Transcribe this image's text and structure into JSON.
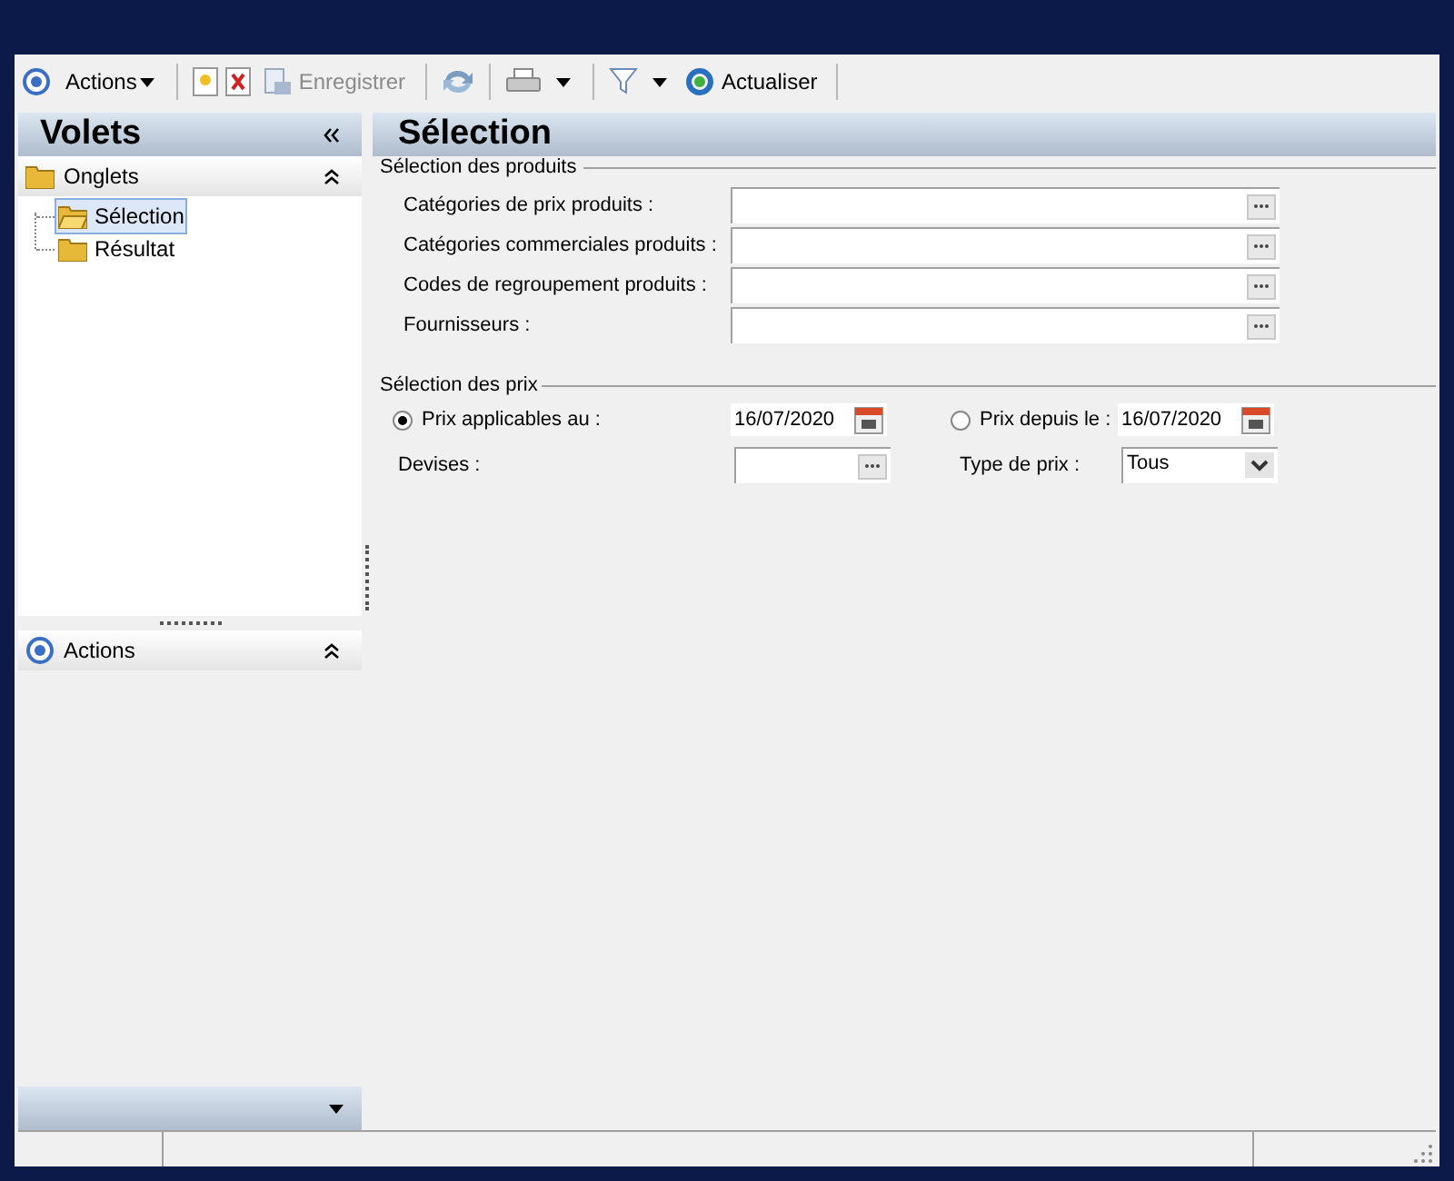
{
  "toolbar": {
    "actions_menu": "Actions",
    "save": {
      "label": "Enregistrer",
      "disabled": true
    },
    "refresh": "Actualiser"
  },
  "sidebar": {
    "title": "Volets",
    "groups": [
      {
        "label": "Onglets",
        "expanded": true,
        "items": [
          {
            "label": "Sélection",
            "selected": true
          },
          {
            "label": "Résultat",
            "selected": false
          }
        ]
      },
      {
        "label": "Actions",
        "expanded": true
      }
    ]
  },
  "main": {
    "title": "Sélection",
    "products_section": {
      "title": "Sélection des produits",
      "fields": [
        {
          "label": "Catégories de prix produits :"
        },
        {
          "label": "Catégories commerciales produits :"
        },
        {
          "label": "Codes de regroupement produits :"
        },
        {
          "label": "Fournisseurs :"
        }
      ]
    },
    "prices_section": {
      "title": "Sélection des prix",
      "options": [
        {
          "label": "Prix applicables au :",
          "selected": true,
          "value": "16/07/2020"
        },
        {
          "label": "Prix depuis le :",
          "selected": false,
          "value": "16/07/2020"
        }
      ],
      "currency": {
        "label": "Devises :"
      },
      "price_type": {
        "label": "Type de prix :",
        "value": "Tous"
      }
    }
  }
}
